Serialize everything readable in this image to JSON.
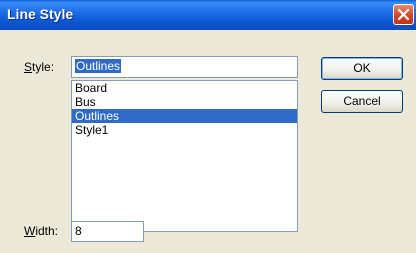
{
  "window": {
    "title": "Line Style",
    "close_icon": "close-icon"
  },
  "style": {
    "label_underlined": "S",
    "label_rest": "tyle:",
    "value": "Outlines",
    "options": [
      "Board",
      "Bus",
      "Outlines",
      "Style1"
    ],
    "selected": "Outlines"
  },
  "buttons": {
    "ok": "OK",
    "cancel": "Cancel"
  },
  "width": {
    "label_underlined": "W",
    "label_rest": "idth:",
    "value": "8"
  },
  "colors": {
    "titlebar": "#0b56d0",
    "dialog_bg": "#ece9d8",
    "selection": "#316ac5",
    "close_button": "#d6452b"
  }
}
